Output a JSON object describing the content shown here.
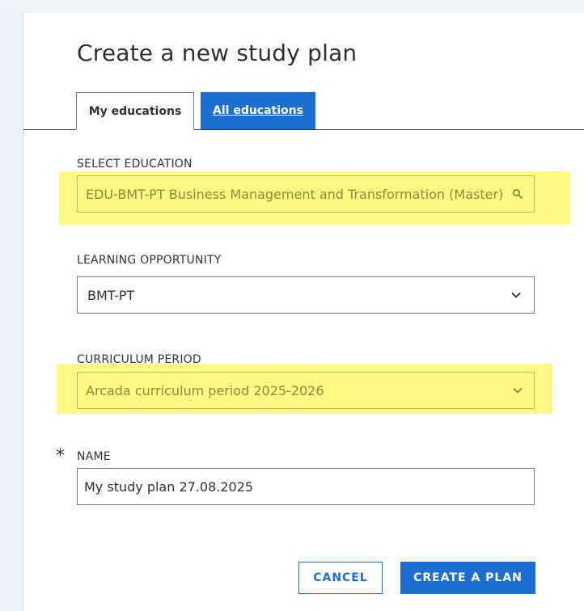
{
  "dialog": {
    "title": "Create a new study plan"
  },
  "tabs": [
    {
      "label": "My educations",
      "active": true
    },
    {
      "label": "All educations",
      "active": false
    }
  ],
  "fields": {
    "education": {
      "label": "SELECT EDUCATION",
      "value": "EDU-BMT-PT Business Management and Transformation (Master)",
      "icon": "search-icon"
    },
    "learning_opportunity": {
      "label": "LEARNING OPPORTUNITY",
      "value": "BMT-PT",
      "icon": "chevron-down-icon"
    },
    "curriculum_period": {
      "label": "CURRICULUM PERIOD",
      "value": "Arcada curriculum period 2025-2026",
      "icon": "chevron-down-icon"
    },
    "name": {
      "label": "NAME",
      "value": "My study plan 27.08.2025",
      "required_marker": "*"
    }
  },
  "buttons": {
    "cancel": "CANCEL",
    "create": "CREATE A PLAN"
  },
  "colors": {
    "primary": "#1c6fd1",
    "highlight": "#fdfa83",
    "text": "#2f2f2f",
    "border": "#777777"
  }
}
